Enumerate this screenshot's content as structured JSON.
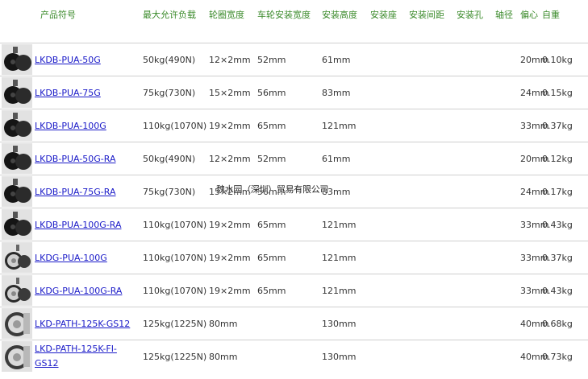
{
  "headers": [
    "产品符号",
    "最大允许负载",
    "轮圈宽度",
    "车轮安装宽度",
    "安装高度",
    "安装座",
    "安装间距",
    "安装孔",
    "轴径",
    "偏心",
    "自重"
  ],
  "rows": [
    {
      "thumb": "black",
      "code": "LKDB-PUA-50G",
      "load": "50kg(490N)",
      "rim": "12×2mm",
      "wheel": "52mm",
      "height": "61mm",
      "seat": "",
      "spacing": "",
      "hole": "",
      "axle": "",
      "offset": "20mm",
      "weight": "0.10kg"
    },
    {
      "thumb": "black",
      "code": "LKDB-PUA-75G",
      "load": "75kg(730N)",
      "rim": "15×2mm",
      "wheel": "56mm",
      "height": "83mm",
      "seat": "",
      "spacing": "",
      "hole": "",
      "axle": "",
      "offset": "24mm",
      "weight": "0.15kg"
    },
    {
      "thumb": "black",
      "code": "LKDB-PUA-100G",
      "load": "110kg(1070N)",
      "rim": "19×2mm",
      "wheel": "65mm",
      "height": "121mm",
      "seat": "",
      "spacing": "",
      "hole": "",
      "axle": "",
      "offset": "33mm",
      "weight": "0.37kg"
    },
    {
      "thumb": "black",
      "code": "LKDB-PUA-50G-RA",
      "load": "50kg(490N)",
      "rim": "12×2mm",
      "wheel": "52mm",
      "height": "61mm",
      "seat": "",
      "spacing": "",
      "hole": "",
      "axle": "",
      "offset": "20mm",
      "weight": "0.12kg"
    },
    {
      "thumb": "black",
      "code": "LKDB-PUA-75G-RA",
      "load": "75kg(730N)",
      "rim": "15×2mm",
      "wheel": "56mm",
      "height": "83mm",
      "seat": "",
      "spacing": "",
      "hole": "",
      "axle": "",
      "offset": "24mm",
      "weight": "0.17kg"
    },
    {
      "thumb": "black",
      "code": "LKDB-PUA-100G-RA",
      "load": "110kg(1070N)",
      "rim": "19×2mm",
      "wheel": "65mm",
      "height": "121mm",
      "seat": "",
      "spacing": "",
      "hole": "",
      "axle": "",
      "offset": "33mm",
      "weight": "0.43kg"
    },
    {
      "thumb": "grey",
      "code": "LKDG-PUA-100G",
      "load": "110kg(1070N)",
      "rim": "19×2mm",
      "wheel": "65mm",
      "height": "121mm",
      "seat": "",
      "spacing": "",
      "hole": "",
      "axle": "",
      "offset": "33mm",
      "weight": "0.37kg"
    },
    {
      "thumb": "grey",
      "code": "LKDG-PUA-100G-RA",
      "load": "110kg(1070N)",
      "rim": "19×2mm",
      "wheel": "65mm",
      "height": "121mm",
      "seat": "",
      "spacing": "",
      "hole": "",
      "axle": "",
      "offset": "33mm",
      "weight": "0.43kg"
    },
    {
      "thumb": "silver",
      "code": "LKD-PATH-125K-GS12",
      "load": "125kg(1225N)",
      "rim": "80mm",
      "wheel": "",
      "height": "130mm",
      "seat": "",
      "spacing": "",
      "hole": "",
      "axle": "",
      "offset": "40mm",
      "weight": "0.68kg"
    },
    {
      "thumb": "silver",
      "code": "LKD-PATH-125K-FI-GS12",
      "load": "125kg(1225N)",
      "rim": "80mm",
      "wheel": "",
      "height": "130mm",
      "seat": "",
      "spacing": "",
      "hole": "",
      "axle": "",
      "offset": "40mm",
      "weight": "0.73kg"
    }
  ],
  "watermark": "魏水园（深圳）贸易有限公司",
  "colors": {
    "header": "#3a8a2a",
    "link": "#1a1ac8",
    "border": "#cfcfcf",
    "thumb_bg": "#e2e2e2"
  }
}
